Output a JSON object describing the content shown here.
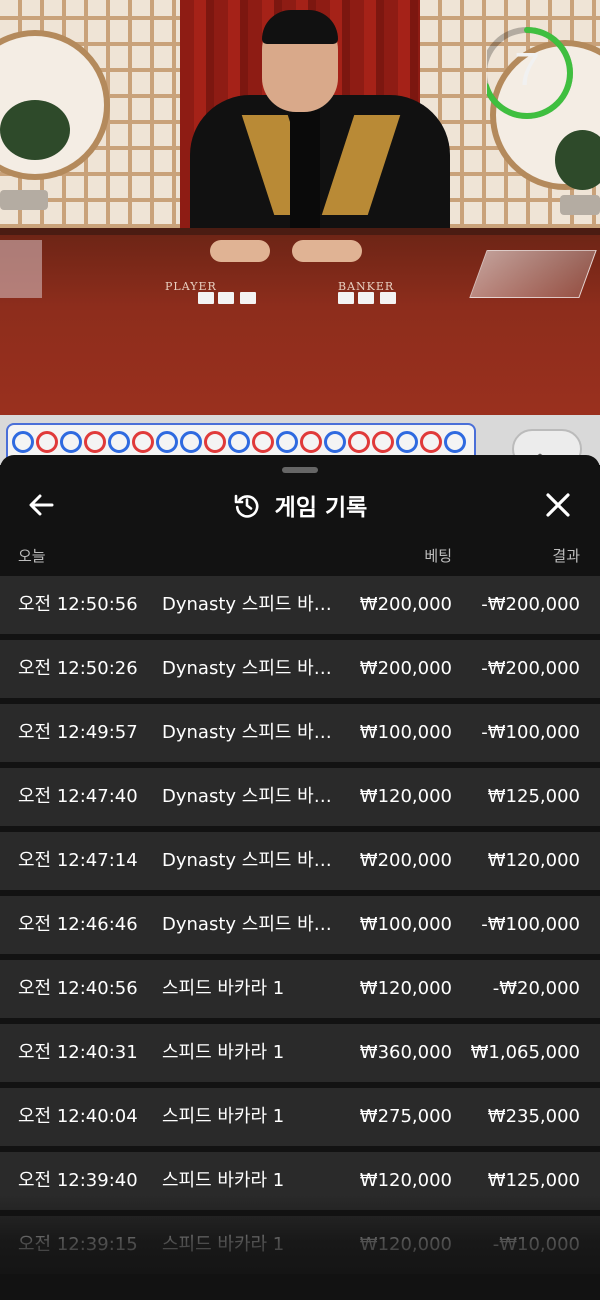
{
  "stream": {
    "countdown": "7",
    "countdown_fraction": 0.7,
    "table_labels": {
      "player": "PLAYER",
      "banker": "BANKER"
    }
  },
  "roadmap": {
    "beads": [
      "P",
      "B",
      "P",
      "B",
      "P",
      "B",
      "P",
      "P",
      "B",
      "P",
      "B",
      "P",
      "B",
      "P",
      "B",
      "B",
      "P",
      "B",
      "P"
    ],
    "colors": {
      "banker": "#e03a3a",
      "player": "#2f6ae0"
    }
  },
  "sheet": {
    "title": "게임 기록",
    "icons": {
      "back": "arrow-left-icon",
      "history": "history-clock-icon",
      "close": "close-x-icon"
    },
    "headers": {
      "date": "오늘",
      "bet": "베팅",
      "result": "결과"
    },
    "rows": [
      {
        "time": "오전 12:50:56",
        "game": "Dynasty 스피드 바카라",
        "bet": "₩200,000",
        "result": "-₩200,000"
      },
      {
        "time": "오전 12:50:26",
        "game": "Dynasty 스피드 바카라",
        "bet": "₩200,000",
        "result": "-₩200,000"
      },
      {
        "time": "오전 12:49:57",
        "game": "Dynasty 스피드 바카라",
        "bet": "₩100,000",
        "result": "-₩100,000"
      },
      {
        "time": "오전 12:47:40",
        "game": "Dynasty 스피드 바카라",
        "bet": "₩120,000",
        "result": "₩125,000"
      },
      {
        "time": "오전 12:47:14",
        "game": "Dynasty 스피드 바카라",
        "bet": "₩200,000",
        "result": "₩120,000"
      },
      {
        "time": "오전 12:46:46",
        "game": "Dynasty 스피드 바카라",
        "bet": "₩100,000",
        "result": "-₩100,000"
      },
      {
        "time": "오전 12:40:56",
        "game": "스피드 바카라 1",
        "bet": "₩120,000",
        "result": "-₩20,000"
      },
      {
        "time": "오전 12:40:31",
        "game": "스피드 바카라 1",
        "bet": "₩360,000",
        "result": "₩1,065,000"
      },
      {
        "time": "오전 12:40:04",
        "game": "스피드 바카라 1",
        "bet": "₩275,000",
        "result": "₩235,000"
      },
      {
        "time": "오전 12:39:40",
        "game": "스피드 바카라 1",
        "bet": "₩120,000",
        "result": "₩125,000"
      },
      {
        "time": "오전 12:39:15",
        "game": "스피드 바카라 1",
        "bet": "₩120,000",
        "result": "-₩10,000"
      }
    ]
  },
  "colors": {
    "timer_ring": "#3fbf3f",
    "row_bg": "#2a2a2a",
    "sheet_bg": "#121212"
  }
}
